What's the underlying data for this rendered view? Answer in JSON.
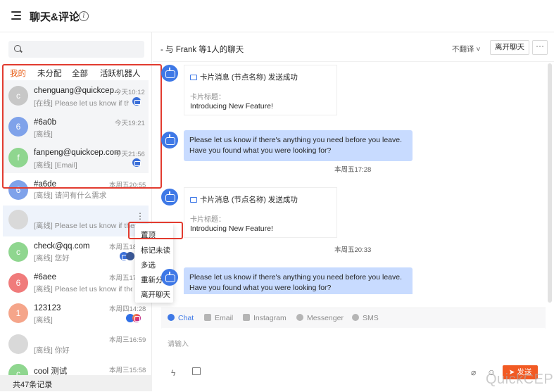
{
  "header": {
    "title": "聊天&评论",
    "info_icon": "info-icon"
  },
  "sidebar": {
    "search": {
      "placeholder": ""
    },
    "tabs": [
      {
        "label": "我的",
        "active": true
      },
      {
        "label": "未分配"
      },
      {
        "label": "全部"
      },
      {
        "label": "活跃机器人"
      }
    ],
    "conversations": [
      {
        "initial": "c",
        "avatar_color": "#c7c7c7",
        "name": "chenguang@quickcep...",
        "preview": "[在线] Please let us know if th...",
        "time": "今天10:12",
        "channels": [
          "email"
        ]
      },
      {
        "initial": "6",
        "avatar_color": "#7fa2ea",
        "name": "#6a0b",
        "preview": "[离线]",
        "time": "今天19:21",
        "channels": []
      },
      {
        "initial": "f",
        "avatar_color": "#8fd68f",
        "name": "fanpeng@quickcep.com",
        "preview": "[离线] [Email]",
        "time": "今天21:56",
        "channels": [
          "email"
        ]
      },
      {
        "initial": "6",
        "avatar_color": "#7fa2ea",
        "name": "#a6de",
        "preview": "[离线] 请问有什么需求",
        "time": "本周五20:55",
        "channels": []
      },
      {
        "initial": "",
        "avatar_color": "#d9d9d9",
        "name": "",
        "preview": "[离线] Please let us know if there",
        "time": "",
        "channels": []
      },
      {
        "initial": "c",
        "avatar_color": "#8fd68f",
        "name": "check@qq.com",
        "preview": "[离线] 您好",
        "time": "本周五18:",
        "channels": [
          "email",
          "fb",
          "msgr"
        ]
      },
      {
        "initial": "6",
        "avatar_color": "#f07b7b",
        "name": "#6aee",
        "preview": "[离线] Please let us know if there'",
        "time": "本周五17:",
        "channels": []
      },
      {
        "initial": "1",
        "avatar_color": "#f5a58a",
        "name": "123123",
        "preview": "[离线]",
        "time": "本周四14:28",
        "channels": [
          "msgr",
          "ig"
        ]
      },
      {
        "initial": "",
        "avatar_color": "#d9d9d9",
        "name": "",
        "preview": "[离线] 你好",
        "time": "本周三16:59",
        "channels": []
      },
      {
        "initial": "c",
        "avatar_color": "#8fd68f",
        "name": "cool 测试",
        "preview": "",
        "time": "本周三15:58",
        "channels": []
      }
    ],
    "footer": "共47条记录",
    "context_menu": [
      "置顶",
      "标记未读",
      "多选",
      "重新分配",
      "离开聊天"
    ]
  },
  "conversation": {
    "title": "- 与 Frank 等1人的聊天",
    "translate": "不翻译",
    "leave_button": "离开聊天",
    "more_button": "···",
    "messages": [
      {
        "type": "card",
        "head": "卡片消息 (节点名称) 发送成功",
        "label": "卡片标题：",
        "text": "Introducing New Feature!"
      },
      {
        "type": "bubble",
        "text": "Please let us know if there's anything you need before you leave. Have you found what you were looking for?",
        "time": "本周五17:28"
      },
      {
        "type": "card",
        "head": "卡片消息 (节点名称) 发送成功",
        "label": "卡片标题：",
        "text": "Introducing New Feature!",
        "time": "本周五20:33"
      },
      {
        "type": "bubble",
        "text": "Please let us know if there's anything you need before you leave. Have you found what you were looking for?"
      }
    ]
  },
  "composer": {
    "channels": [
      {
        "label": "Chat",
        "active": true
      },
      {
        "label": "Email"
      },
      {
        "label": "Instagram"
      },
      {
        "label": "Messenger"
      },
      {
        "label": "SMS"
      }
    ],
    "placeholder": "请输入",
    "send_label": "发送",
    "tools": [
      "lightning-icon",
      "image-icon",
      "attach-icon",
      "emoji-icon"
    ]
  },
  "watermark": "QuickCEP",
  "colors": {
    "accent": "#e8611b",
    "brand_blue": "#3e78e6",
    "bubble": "#c8dbff",
    "highlight_box": "#e23b2f",
    "send": "#f25a23"
  }
}
